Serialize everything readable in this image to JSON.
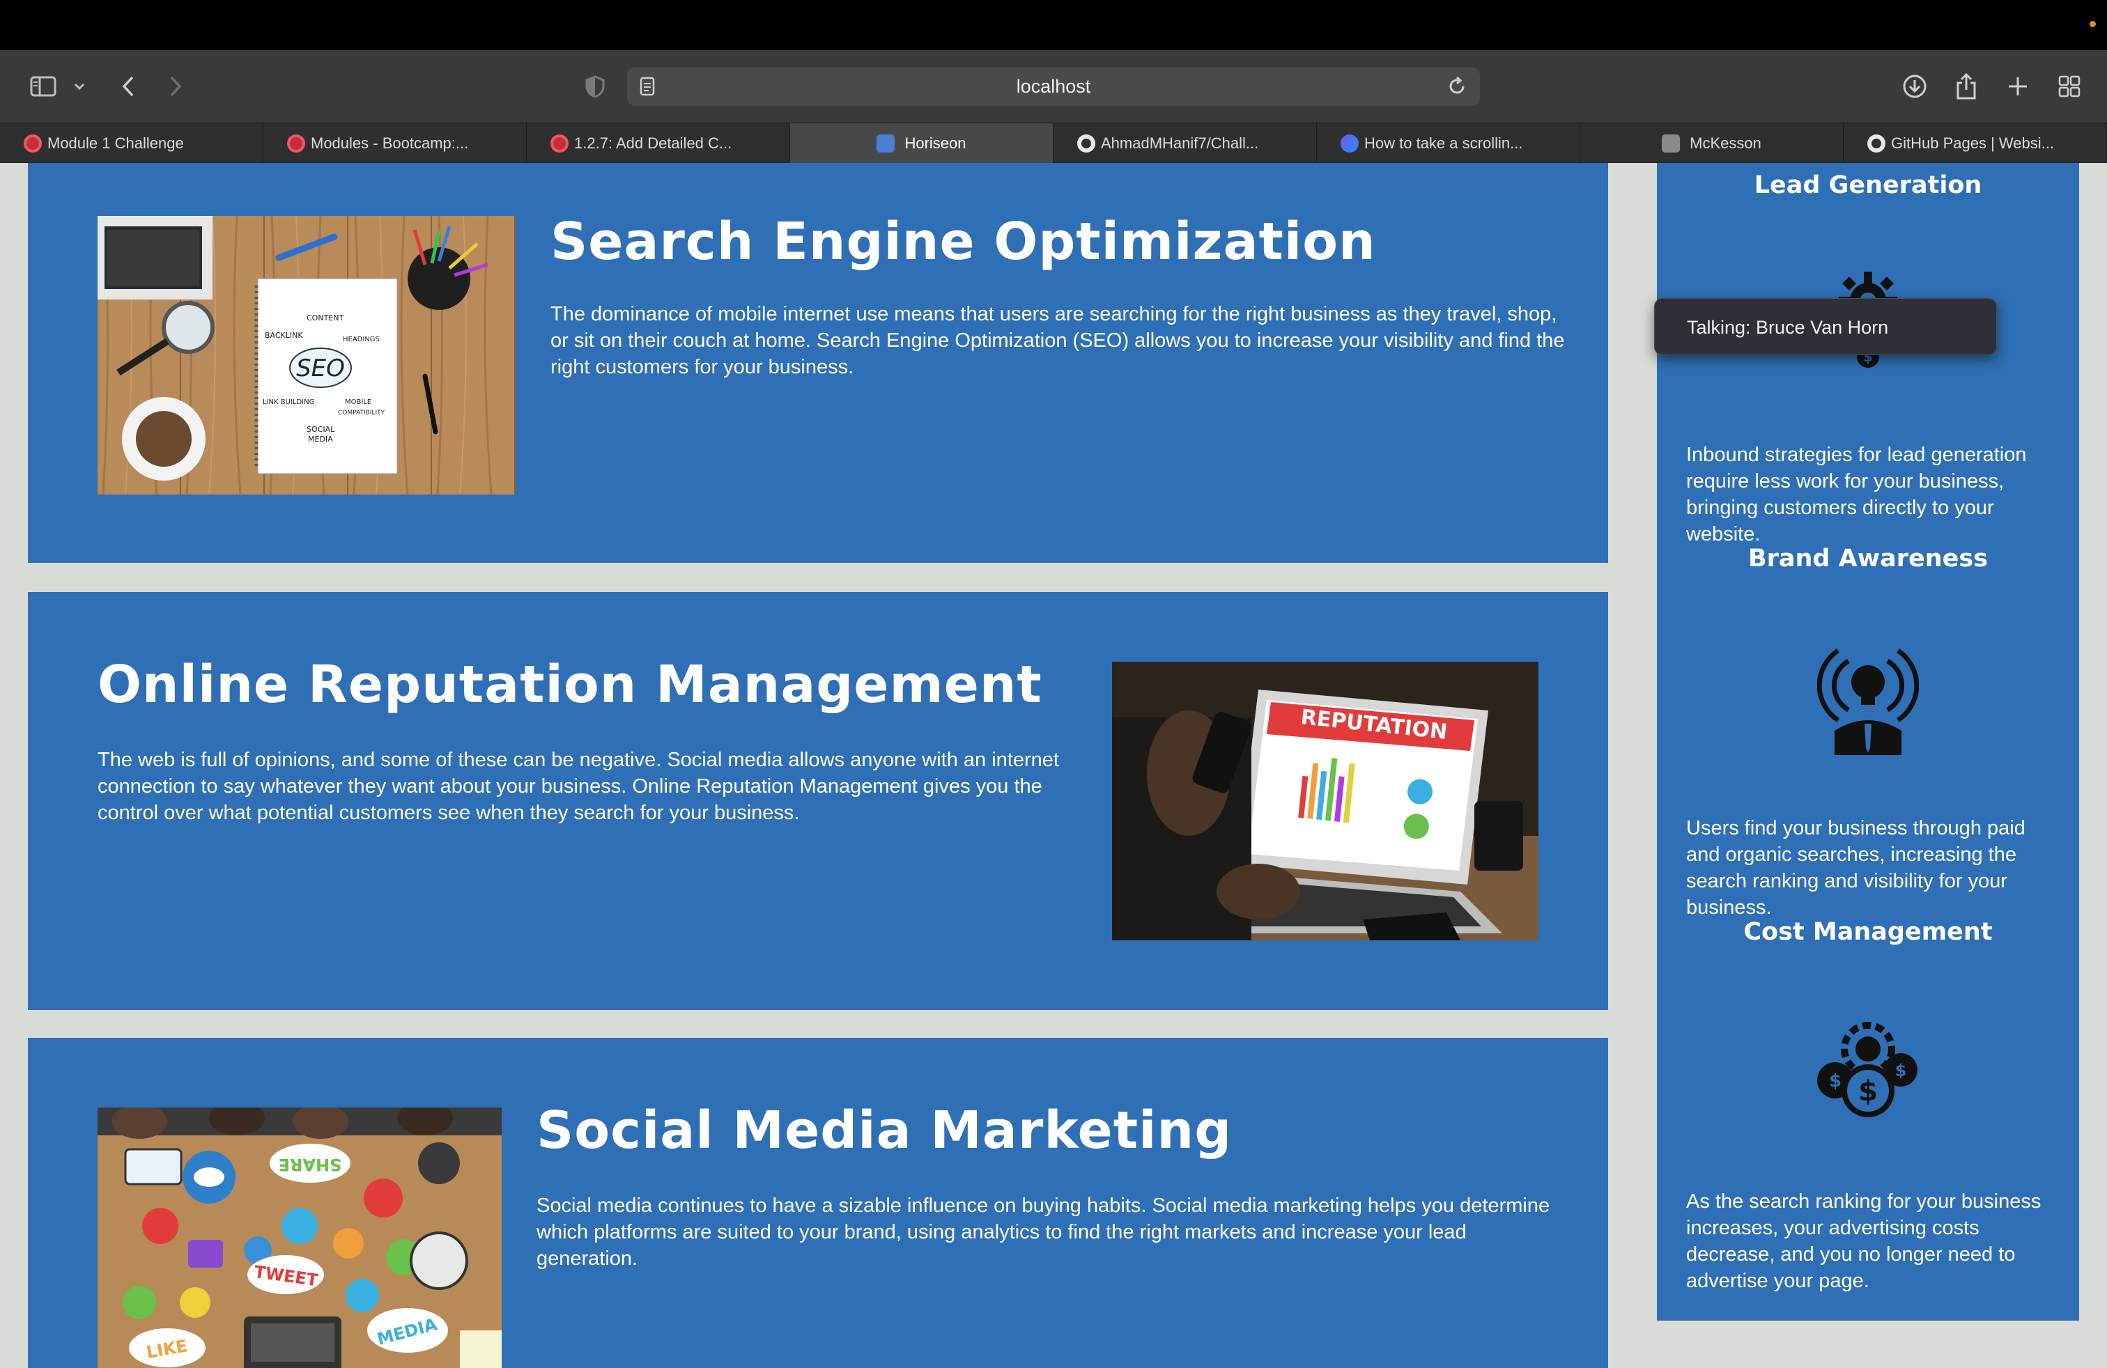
{
  "browser": {
    "url": "localhost",
    "tabs": [
      {
        "label": "Module 1 Challenge",
        "icon": "bootcamp-icon",
        "active": false
      },
      {
        "label": "Modules - Bootcamp:...",
        "icon": "bootcamp-icon",
        "active": false
      },
      {
        "label": "1.2.7: Add Detailed C...",
        "icon": "bootcamp-icon",
        "active": false
      },
      {
        "label": "Horiseon",
        "icon": "horiseon-icon",
        "active": true
      },
      {
        "label": "AhmadMHanif7/Chall...",
        "icon": "github-icon",
        "active": false
      },
      {
        "label": "How to take a scrollin...",
        "icon": "app-icon",
        "active": false
      },
      {
        "label": "McKesson",
        "icon": "mckesson-icon",
        "active": false
      },
      {
        "label": "GitHub Pages | Websi...",
        "icon": "github-icon",
        "active": false
      }
    ]
  },
  "sections": {
    "seo": {
      "title": "Search Engine Optimization",
      "text": "The dominance of mobile internet use means that users are searching for the right business as they travel, shop, or sit on their couch at home. Search Engine Optimization (SEO) allows you to increase your visibility and find the right customers for your business.",
      "image_words": {
        "center": "SEO",
        "backlink": "BACKLINK",
        "content": "CONTENT",
        "headings": "HEADINGS",
        "link_building": "LINK BUILDING",
        "mobile": "MOBILE",
        "compatibility": "COMPATIBILITY",
        "social": "SOCIAL",
        "media": "MEDIA"
      }
    },
    "orm": {
      "title": "Online Reputation Management",
      "text": "The web is full of opinions, and some of these can be negative. Social media allows anyone with an internet connection to say whatever they want about your business. Online Reputation Management gives you the control over what potential customers see when they search for your business.",
      "image_word": "REPUTATION"
    },
    "smm": {
      "title": "Social Media Marketing",
      "text": "Social media continues to have a sizable influence on buying habits. Social media marketing helps you determine which platforms are suited to your brand, using analytics to find the right markets and increase your lead generation.",
      "image_words": {
        "share": "SHARE",
        "tweet": "TWEET",
        "like": "LIKE",
        "media": "MEDIA"
      }
    }
  },
  "sidebar": {
    "lead": {
      "title": "Lead Generation",
      "text": "Inbound strategies for lead generation require less work for your business, bringing customers directly to your website."
    },
    "brand": {
      "title": "Brand Awareness",
      "text": "Users find your business through paid and organic searches, increasing the search ranking and visibility for your business."
    },
    "cost": {
      "title": "Cost Management",
      "text": "As the search ranking for your business increases, your advertising costs decrease, and you no longer need to advertise your page."
    }
  },
  "tooltip": {
    "text": "Talking: Bruce Van Horn"
  },
  "colors": {
    "accent": "#2f6fb5",
    "page_bg": "#d9dcd6",
    "chrome": "#3a3a3c"
  }
}
